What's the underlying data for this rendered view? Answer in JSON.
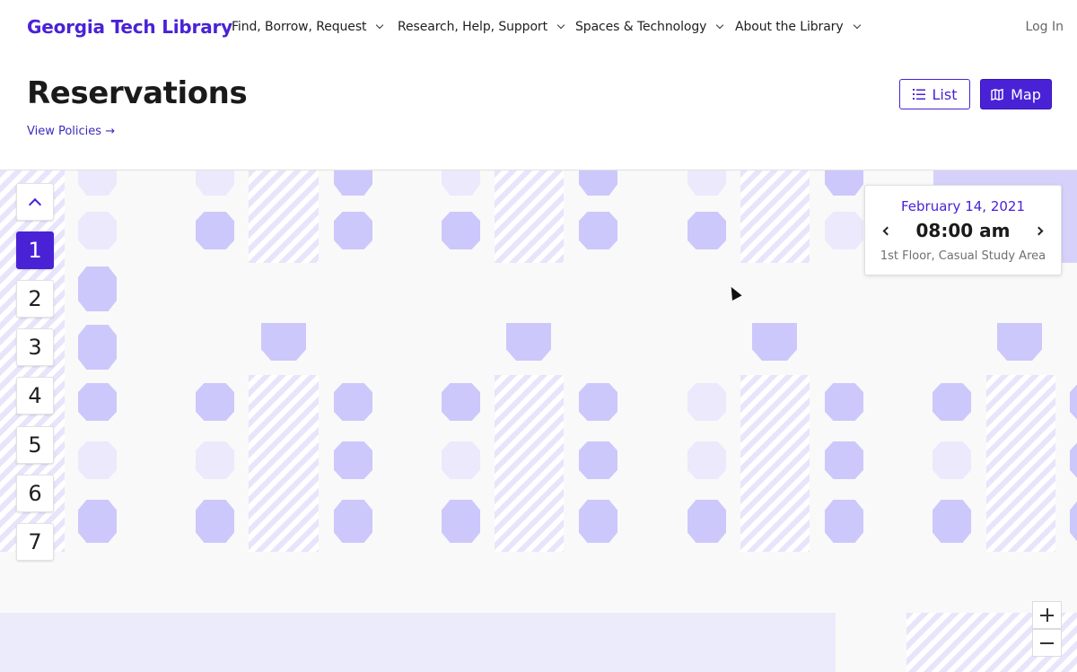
{
  "header": {
    "brand": "Georgia Tech Library",
    "nav": [
      {
        "label": "Find, Borrow, Request"
      },
      {
        "label": "Research, Help, Support"
      },
      {
        "label": "Spaces & Technology"
      },
      {
        "label": "About the Library"
      }
    ],
    "login": "Log In"
  },
  "page": {
    "title": "Reservations",
    "policies_link": "View Policies →"
  },
  "view_toggle": {
    "list_label": "List",
    "map_label": "Map",
    "active": "Map"
  },
  "floors": {
    "selected": "1",
    "items": [
      "1",
      "2",
      "3",
      "4",
      "5",
      "6",
      "7"
    ]
  },
  "reservation": {
    "date": "February 14, 2021",
    "time": "08:00 am",
    "location": "1st Floor, Casual Study Area"
  },
  "colors": {
    "accent": "#4a22d6",
    "seat_available": "#ccc8fb",
    "seat_unavailable": "#ece9fc",
    "map_background": "#f9f9f9"
  },
  "icons": {
    "list": "list-icon",
    "map": "map-icon",
    "up": "chevron-up-icon",
    "prev": "chevron-left-icon",
    "next": "chevron-right-icon",
    "zoom_in": "plus-icon",
    "zoom_out": "minus-icon"
  }
}
